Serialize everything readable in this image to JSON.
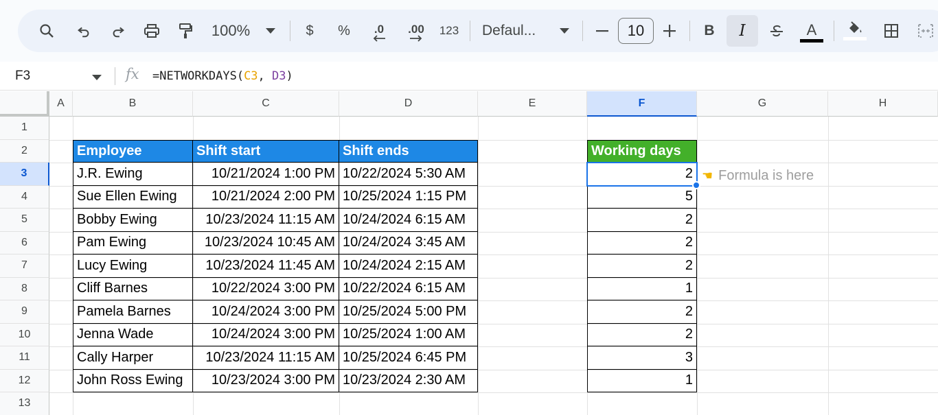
{
  "toolbar": {
    "zoom": "100%",
    "currency": "$",
    "percent": "%",
    "decrease_decimal": ".0",
    "increase_decimal": ".00",
    "number_format": "123",
    "font_family": "Defaul...",
    "font_size": "10",
    "bold": "B",
    "italic": "I",
    "text_color_letter": "A"
  },
  "formula_bar": {
    "cell_ref": "F3",
    "fx": "fx",
    "formula_prefix": "=NETWORKDAYS(",
    "ref1": "C3",
    "sep": ", ",
    "ref2": "D3",
    "formula_suffix": ")"
  },
  "columns": [
    "A",
    "B",
    "C",
    "D",
    "E",
    "F",
    "G",
    "H"
  ],
  "rows": [
    "1",
    "2",
    "3",
    "4",
    "5",
    "6",
    "7",
    "8",
    "9",
    "10",
    "11",
    "12",
    "13"
  ],
  "table": {
    "headers": [
      "Employee",
      "Shift start",
      "Shift ends"
    ],
    "working_days_header": "Working days",
    "rows": [
      {
        "employee": "J.R. Ewing",
        "start": "10/21/2024 1:00 PM",
        "end": "10/22/2024 5:30 AM",
        "days": "2"
      },
      {
        "employee": "Sue Ellen Ewing",
        "start": "10/21/2024 2:00 PM",
        "end": "10/25/2024 1:15 PM",
        "days": "5"
      },
      {
        "employee": "Bobby Ewing",
        "start": "10/23/2024 11:15 AM",
        "end": "10/24/2024 6:15 AM",
        "days": "2"
      },
      {
        "employee": "Pam Ewing",
        "start": "10/23/2024 10:45 AM",
        "end": "10/24/2024 3:45 AM",
        "days": "2"
      },
      {
        "employee": "Lucy Ewing",
        "start": "10/23/2024 11:45 AM",
        "end": "10/24/2024 2:15 AM",
        "days": "2"
      },
      {
        "employee": "Cliff Barnes",
        "start": "10/22/2024 3:00 PM",
        "end": "10/22/2024 6:15 AM",
        "days": "1"
      },
      {
        "employee": "Pamela Barnes",
        "start": "10/24/2024 3:00 PM",
        "end": "10/25/2024 5:00 PM",
        "days": "2"
      },
      {
        "employee": "Jenna Wade",
        "start": "10/24/2024 3:00 PM",
        "end": "10/25/2024 1:00 AM",
        "days": "2"
      },
      {
        "employee": "Cally Harper",
        "start": "10/23/2024 11:15 AM",
        "end": "10/25/2024 6:45 PM",
        "days": "3"
      },
      {
        "employee": "John Ross Ewing",
        "start": "10/23/2024 3:00 PM",
        "end": "10/23/2024 2:30 AM",
        "days": "1"
      }
    ]
  },
  "note": {
    "icon": "pointing-hand-icon",
    "text": "Formula is here"
  },
  "colors": {
    "header_blue": "#1e88e5",
    "header_green": "#43b02a",
    "selection": "#1a73e8"
  }
}
